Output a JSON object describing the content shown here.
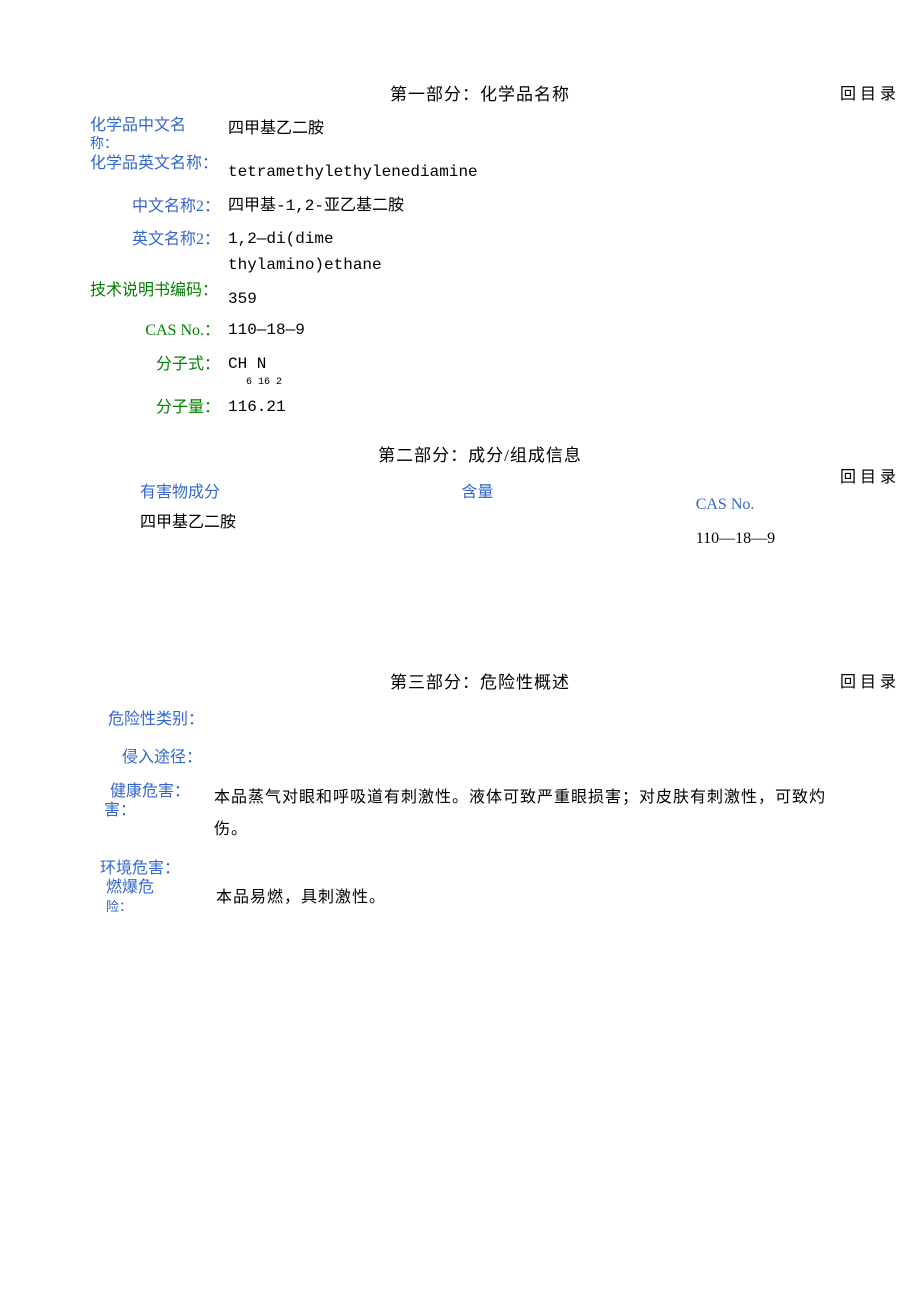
{
  "back_link": "回目录",
  "section1": {
    "title": "第一部分：化学品名称",
    "fields": {
      "chinese_name_label": "化学品中文名",
      "chinese_name_label2": "称：",
      "chinese_name": "四甲基乙二胺",
      "english_name_label": "化学品英文名称：",
      "english_name": "tetramethylethylenediamine",
      "chinese_name2_label": "中文名称2：",
      "chinese_name2": "四甲基-1,2-亚乙基二胺",
      "english_name2_label": "英文名称2：",
      "english_name2": "1,2—di(dime thylamino)ethane",
      "tech_code_label": "技术说明书编码：",
      "tech_code": "359",
      "cas_label": "CAS No.：",
      "cas": "110—18—9",
      "formula_label": "分子式：",
      "formula_main": "CH N",
      "formula_sub": "6 16 2",
      "mol_weight_label": "分子量：",
      "mol_weight": "116.21"
    }
  },
  "section2": {
    "title": "第二部分：成分/组成信息",
    "headers": {
      "component": "有害物成分",
      "content": "含量",
      "cas": "CAS No."
    },
    "row": {
      "component": "四甲基乙二胺",
      "content": "",
      "cas": "110—18—9"
    }
  },
  "section3": {
    "title": "第三部分：危险性概述",
    "fields": {
      "category_label": "危险性类别：",
      "category": "",
      "route_label": "侵入途径：",
      "route": "",
      "health_label": "健康危害：",
      "health": "本品蒸气对眼和呼吸道有刺激性。液体可致严重眼损害；对皮肤有刺激性，可致灼伤。",
      "env_label": "环境危害：",
      "env": "",
      "fire_label1": "燃爆危",
      "fire_label2": "险：",
      "fire": "本品易燃，具刺激性。"
    }
  }
}
